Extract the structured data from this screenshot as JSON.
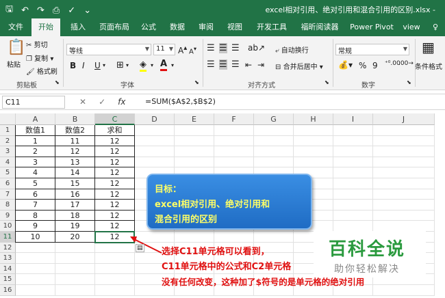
{
  "window": {
    "title": "excel相对引用、绝对引用和混合引用的区别.xlsx - "
  },
  "tabs": [
    "文件",
    "开始",
    "插入",
    "页面布局",
    "公式",
    "数据",
    "审阅",
    "视图",
    "开发工具",
    "福昕阅读器",
    "Power Pivot",
    "view"
  ],
  "ribbon": {
    "paste": "粘贴",
    "cut": "剪切",
    "copy": "复制",
    "format_painter": "格式刷",
    "clipboard_label": "剪贴板",
    "font_name": "等线",
    "font_size": "11",
    "grow_font": "A",
    "shrink_font": "A",
    "bold": "B",
    "italic": "I",
    "underline": "U",
    "font_label": "字体",
    "wrap_text": "自动换行",
    "merge_center": "合并后居中",
    "align_label": "对齐方式",
    "number_format": "常规",
    "percent": "%",
    "comma": "9",
    "number_label": "数字",
    "conditional_format": "条件格式"
  },
  "formula_bar": {
    "name_box": "C11",
    "formula": "=SUM($A$2,$B$2)"
  },
  "columns": [
    "A",
    "B",
    "C",
    "D",
    "E",
    "F",
    "G",
    "H",
    "I",
    "J"
  ],
  "rows": [
    {
      "n": "1",
      "a": "数值1",
      "b": "数值2",
      "c": "求和"
    },
    {
      "n": "2",
      "a": "1",
      "b": "11",
      "c": "12"
    },
    {
      "n": "3",
      "a": "2",
      "b": "12",
      "c": "12"
    },
    {
      "n": "4",
      "a": "3",
      "b": "13",
      "c": "12"
    },
    {
      "n": "5",
      "a": "4",
      "b": "14",
      "c": "12"
    },
    {
      "n": "6",
      "a": "5",
      "b": "15",
      "c": "12"
    },
    {
      "n": "7",
      "a": "6",
      "b": "16",
      "c": "12"
    },
    {
      "n": "8",
      "a": "7",
      "b": "17",
      "c": "12"
    },
    {
      "n": "9",
      "a": "8",
      "b": "18",
      "c": "12"
    },
    {
      "n": "10",
      "a": "9",
      "b": "19",
      "c": "12"
    },
    {
      "n": "11",
      "a": "10",
      "b": "20",
      "c": "12"
    },
    {
      "n": "12",
      "a": "",
      "b": "",
      "c": ""
    },
    {
      "n": "13",
      "a": "",
      "b": "",
      "c": ""
    },
    {
      "n": "14",
      "a": "",
      "b": "",
      "c": ""
    },
    {
      "n": "15",
      "a": "",
      "b": "",
      "c": ""
    },
    {
      "n": "16",
      "a": "",
      "b": "",
      "c": ""
    }
  ],
  "callout": {
    "line1": "目标：",
    "line2": "excel相对引用、绝对引用和",
    "line3": "混合引用的区别"
  },
  "annotation": {
    "line1": "选择C11单元格可以看到，",
    "line2": "C11单元格中的公式和C2单元格",
    "line3": "没有任何改变，这种加了$符号的是单元格的绝对引用"
  },
  "watermark": {
    "brand": "百科全说",
    "slogan": "助你轻松解决"
  },
  "colors": {
    "excel_green": "#217346",
    "callout_text": "#ffff66",
    "annotation": "#e01010",
    "watermark": "#2a9a3e"
  }
}
